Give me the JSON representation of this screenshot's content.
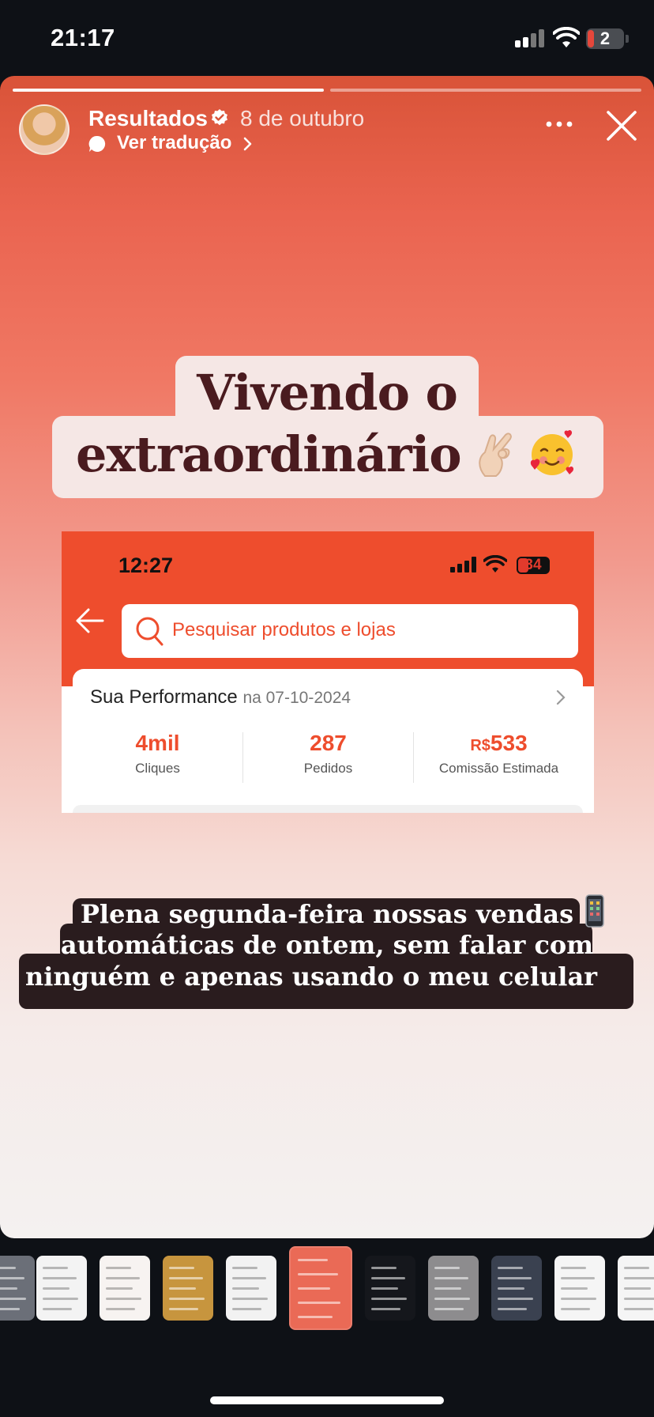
{
  "status_bar": {
    "time": "21:17",
    "battery_label": "2",
    "icons": [
      "cellular-signal-icon",
      "wifi-icon",
      "battery-icon"
    ]
  },
  "story": {
    "segments_total": 2,
    "segments_viewed": 1,
    "header": {
      "username": "Resultados",
      "verified": true,
      "date": "8 de outubro",
      "translate_label": "Ver tradução"
    },
    "headline": {
      "line1": "Vivendo o",
      "line2": "extraordinário",
      "emoji": [
        "ok-hand-icon",
        "smile-hearts-icon"
      ]
    },
    "screenshot": {
      "time": "12:27",
      "battery_label": "34",
      "battery_level": 0.34,
      "search_placeholder": "Pesquisar produtos e lojas",
      "performance_title": "Sua Performance",
      "performance_date": "na 07-10-2024",
      "stats": [
        {
          "currency": "",
          "value": "4mil",
          "label": "Cliques"
        },
        {
          "currency": "",
          "value": "287",
          "label": "Pedidos"
        },
        {
          "currency": "R$",
          "value": "533",
          "label": "Comissão Estimada"
        }
      ]
    },
    "caption": {
      "line1": "Plena segunda-feira nossas vendas",
      "line2": "automáticas de ontem, sem falar com",
      "line3": "ninguém e apenas usando o meu celular",
      "emoji": "mobile-phone-icon"
    }
  },
  "tray": {
    "thumbnails": [
      {
        "name": "thumb-partial-left",
        "bg": "#6b6f78"
      },
      {
        "name": "thumb-1",
        "bg": "#f3f3f3"
      },
      {
        "name": "thumb-2",
        "bg": "#f7f3f1"
      },
      {
        "name": "thumb-3",
        "bg": "#c7953e"
      },
      {
        "name": "thumb-4",
        "bg": "#f2f2f2"
      },
      {
        "name": "thumb-current",
        "bg": "#ea6a56"
      },
      {
        "name": "thumb-6",
        "bg": "#15171c"
      },
      {
        "name": "thumb-7",
        "bg": "#8d8c8e"
      },
      {
        "name": "thumb-8",
        "bg": "#3a4150"
      },
      {
        "name": "thumb-9",
        "bg": "#f5f5f5"
      },
      {
        "name": "thumb-partial-right",
        "bg": "#f5f5f5"
      }
    ],
    "selected_index": 5
  },
  "colors": {
    "shopee_orange": "#ee4d2d",
    "headline_text": "#4a1b1f",
    "headline_bg": "#f5e7e5",
    "caption_bg": "#2a1c1e"
  }
}
